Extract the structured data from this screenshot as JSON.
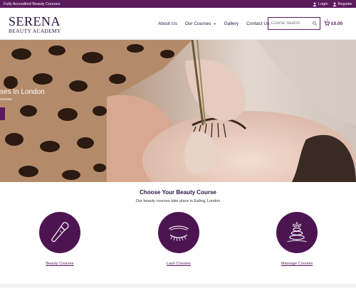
{
  "topbar": {
    "notice": "Fully Accredited Beauty Courses",
    "login": "Login",
    "register": "Register"
  },
  "header": {
    "logo_main": "SERENA",
    "logo_sub": "BEAUTY ACADEMY",
    "nav": [
      "About Us",
      "Our Courses",
      "Gallery",
      "Contact Us"
    ],
    "search_placeholder": "Course Search",
    "cart_total": "£0.00",
    "cart_count": "0"
  },
  "hero": {
    "title": "ses In London",
    "subtitle": "ourses"
  },
  "courses": {
    "title": "Choose Your Beauty Course",
    "subtitle": "Our beauty courses take place in Ealing, London",
    "items": [
      {
        "label": "Beauty Courses",
        "icon": "makeup-brush-icon"
      },
      {
        "label": "Lash Courses",
        "icon": "eyelash-icon"
      },
      {
        "label": "Massage Courses",
        "icon": "spa-stones-icon"
      }
    ]
  },
  "colors": {
    "brand_purple": "#5a1a5c",
    "circle_purple": "#4c1551",
    "logo_text": "#2a1440"
  }
}
